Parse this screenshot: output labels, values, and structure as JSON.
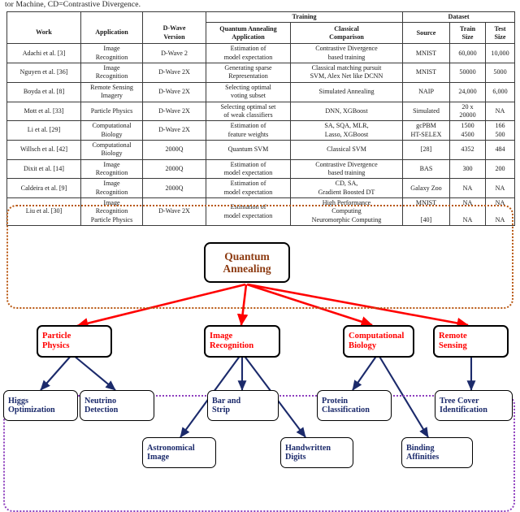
{
  "caption_fragment": "tor Machine, CD=Contrastive Divergence.",
  "table": {
    "group_headers": {
      "training": "Training",
      "dataset": "Dataset"
    },
    "columns": {
      "work": "Work",
      "application": "Application",
      "dwave_version": "D-Wave\nVersion",
      "qa_application": "Quantum Annealing\nApplication",
      "classical_comparison": "Classical\nComparison",
      "source": "Source",
      "train_size": "Train\nSize",
      "test_size": "Test\nSize"
    },
    "rows": [
      {
        "work": "Adachi et al. [3]",
        "application": "Image\nRecognition",
        "dwave_version": "D-Wave 2",
        "qa_application": "Estimation of\nmodel expectation",
        "classical_comparison": "Contrastive Divergence\nbased training",
        "source": "MNIST",
        "train_size": "60,000",
        "test_size": "10,000"
      },
      {
        "work": "Nguyen et al. [36]",
        "application": "Image\nRecognition",
        "dwave_version": "D-Wave 2X",
        "qa_application": "Generating sparse\nRepresentation",
        "classical_comparison": "Classical matching pursuit\nSVM, Alex Net like DCNN",
        "source": "MNIST",
        "train_size": "50000",
        "test_size": "5000"
      },
      {
        "work": "Boyda et al. [8]",
        "application": "Remote Sensing\nImagery",
        "dwave_version": "D-Wave 2X",
        "qa_application": "Selecting optimal\nvoting subset",
        "classical_comparison": "Simulated Annealing",
        "source": "NAIP",
        "train_size": "24,000",
        "test_size": "6,000"
      },
      {
        "work": "Mott et al. [33]",
        "application": "Particle Physics",
        "dwave_version": "D-Wave 2X",
        "qa_application": "Selecting optimal set\nof weak classifiers",
        "classical_comparison": "DNN, XGBoost",
        "source": "Simulated",
        "train_size": "20 x\n20000",
        "test_size": "NA"
      },
      {
        "work": "Li et al. [29]",
        "application": "Computational\nBiology",
        "dwave_version": "D-Wave 2X",
        "qa_application": "Estimation of\nfeature weights",
        "classical_comparison": "SA, SQA, MLR,\nLasso, XGBoost",
        "source": "gcPBM\nHT-SELEX",
        "train_size": "1500\n4500",
        "test_size": "166\n500"
      },
      {
        "work": "Willsch et al. [42]",
        "application": "Computational\nBiology",
        "dwave_version": "2000Q",
        "qa_application": "Quantum SVM",
        "classical_comparison": "Classical SVM",
        "source": "[28]",
        "train_size": "4352",
        "test_size": "484"
      },
      {
        "work": "Dixit et al. [14]",
        "application": "Image\nRecognition",
        "dwave_version": "2000Q",
        "qa_application": "Estimation of\nmodel expectation",
        "classical_comparison": "Contrastive Divergence\nbased training",
        "source": "BAS",
        "train_size": "300",
        "test_size": "200"
      },
      {
        "work": "Caldeira et al. [9]",
        "application": "Image\nRecognition",
        "dwave_version": "2000Q",
        "qa_application": "Estimation of\nmodel expectation",
        "classical_comparison": "CD, SA,\nGradient Boosted DT",
        "source": "Galaxy Zoo",
        "train_size": "NA",
        "test_size": "NA"
      },
      {
        "work": "Liu et al. [30]",
        "application": "Image\nRecognition\nParticle Physics",
        "dwave_version": "D-Wave 2X",
        "qa_application": "Estimation of\nmodel expectation",
        "classical_comparison": "High Performance\nComputing\nNeuromorphic Computing",
        "source": "MNIST\n\n[40]",
        "train_size": "NA\n\nNA",
        "test_size": "NA\n\nNA"
      }
    ]
  },
  "diagram": {
    "root": {
      "label": "Quantum\nAnnealing"
    },
    "level2": [
      {
        "label": "Particle\nPhysics"
      },
      {
        "label": "Image\nRecognition"
      },
      {
        "label": "Computational\nBiology"
      },
      {
        "label": "Remote\nSensing"
      }
    ],
    "level3": [
      {
        "label": "Higgs\nOptimization"
      },
      {
        "label": "Neutrino\nDetection"
      },
      {
        "label": "Astronomical\nImage"
      },
      {
        "label": "Bar and\nStrip"
      },
      {
        "label": "Handwritten\nDigits"
      },
      {
        "label": "Protein\nClassification"
      },
      {
        "label": "Binding\nAffinities"
      },
      {
        "label": "Tree Cover\nIdentification"
      }
    ],
    "colors": {
      "root_text": "#8c3a10",
      "level2_text": "#ff0000",
      "level3_text": "#1b2a6b",
      "root_edges": "#ff0000",
      "branch_edges": "#1b2a6b",
      "applications_group_border": "#b8560f",
      "usecases_group_border": "#8e3fbe"
    }
  }
}
